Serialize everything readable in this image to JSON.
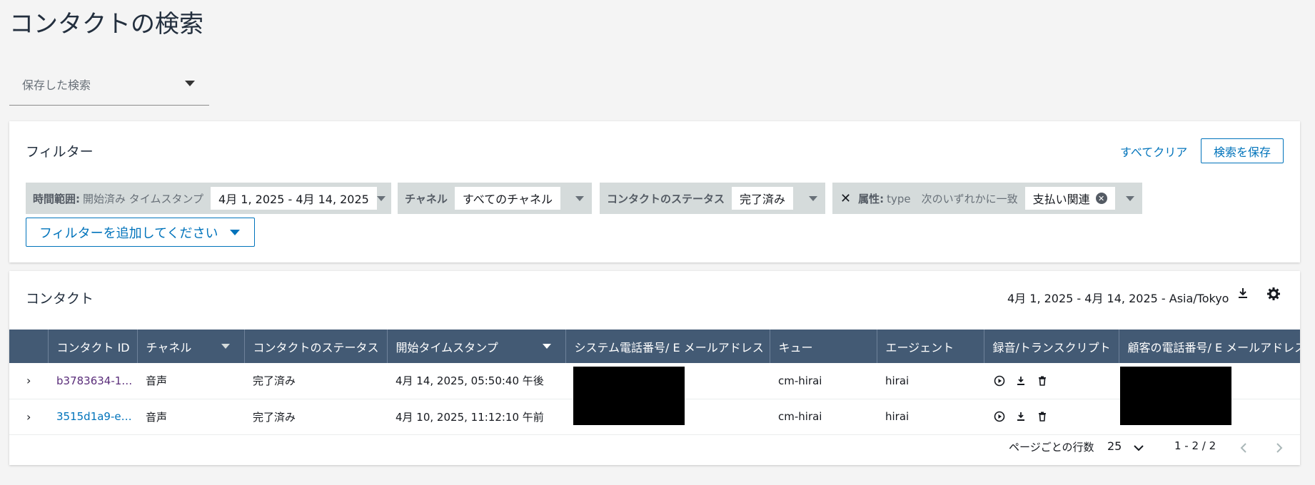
{
  "page_title": "コンタクトの検索",
  "saved_search": {
    "placeholder": "保存した検索"
  },
  "filters": {
    "title": "フィルター",
    "clear_all": "すべてクリア",
    "save_search": "検索を保存",
    "add_filter": "フィルターを追加してください",
    "chips": [
      {
        "key": "時間範囲:",
        "sub": "開始済み タイムスタンプ",
        "value": "4月 1, 2025 - 4月 14, 2025"
      },
      {
        "key": "チャネル",
        "value": "すべてのチャネル"
      },
      {
        "key": "コンタクトのステータス",
        "value": "完了済み"
      },
      {
        "key": "属性:",
        "sub": "type　次のいずれかに一致",
        "value": "支払い関連"
      }
    ]
  },
  "contacts": {
    "title": "コンタクト",
    "range": "4月 1, 2025 - 4月 14, 2025 - Asia/Tokyo",
    "columns": [
      "コンタクト ID",
      "チャネル",
      "コンタクトのステータス",
      "開始タイムスタンプ",
      "システム電話番号/ E メールアドレス",
      "キュー",
      "エージェント",
      "録音/トランスクリプト",
      "顧客の電話番号/ E メールアドレス"
    ],
    "rows": [
      {
        "id": "b3783634-1…",
        "channel": "音声",
        "status": "完了済み",
        "start": "4月 14, 2025, 05:50:40 午後",
        "queue": "cm-hirai",
        "agent": "hirai"
      },
      {
        "id": "3515d1a9-e…",
        "channel": "音声",
        "status": "完了済み",
        "start": "4月 10, 2025, 11:12:10 午前",
        "queue": "cm-hirai",
        "agent": "hirai"
      }
    ],
    "pagination": {
      "rows_per_page_label": "ページごとの行数",
      "rows_per_page": "25",
      "range": "1 - 2 / 2"
    }
  },
  "colors": {
    "accent": "#0073bb",
    "header_bg": "#435a74",
    "chip_bg": "#d5dbdb",
    "page_bg": "#f4f4f4"
  }
}
